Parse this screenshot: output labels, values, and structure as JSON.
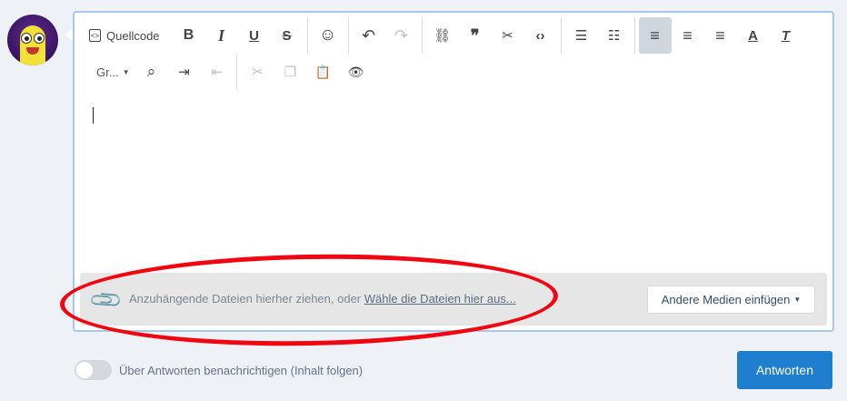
{
  "toolbar": {
    "source_label": "Quellcode",
    "row1": [
      {
        "name": "bold-icon",
        "glyph": "B"
      },
      {
        "name": "italic-icon",
        "glyph": "I"
      },
      {
        "name": "underline-icon",
        "glyph": "U"
      },
      {
        "name": "strikethrough-icon",
        "glyph": "S"
      },
      {
        "name": "emoji-icon",
        "glyph": "☺"
      },
      {
        "name": "undo-icon",
        "glyph": "↶"
      },
      {
        "name": "redo-icon",
        "glyph": "↷"
      },
      {
        "name": "link-icon",
        "glyph": "⛓"
      },
      {
        "name": "quote-icon",
        "glyph": "❞"
      },
      {
        "name": "unlink-icon",
        "glyph": "✂"
      },
      {
        "name": "code-icon",
        "glyph": "‹›"
      },
      {
        "name": "ordered-list-icon",
        "glyph": "☰"
      },
      {
        "name": "unordered-list-icon",
        "glyph": "☷"
      },
      {
        "name": "align-left-icon",
        "glyph": "≡"
      },
      {
        "name": "align-center-icon",
        "glyph": "≡"
      },
      {
        "name": "align-right-icon",
        "glyph": "≡"
      },
      {
        "name": "text-color-icon",
        "glyph": "A"
      },
      {
        "name": "clear-format-icon",
        "glyph": "T"
      }
    ],
    "font_size_label": "Gr...",
    "row2_icons": {
      "find": "⌕",
      "indent": "⇥",
      "outdent": "⇤",
      "cut": "✂",
      "copy": "❐",
      "paste": "📋",
      "preview": "👁"
    }
  },
  "upload": {
    "text": "Anzuhängende Dateien hierher ziehen, oder",
    "link": "Wähle die Dateien hier aus...",
    "media_button": "Andere Medien einfügen",
    "clip_glyph": "📎"
  },
  "footer": {
    "notify_label": "Über Antworten benachrichtigen (Inhalt folgen)",
    "notify_on": false,
    "reply_button": "Antworten"
  },
  "colors": {
    "accent": "#1f7fce",
    "annotation": "#f00510",
    "editor_border": "#a7c8ec"
  }
}
